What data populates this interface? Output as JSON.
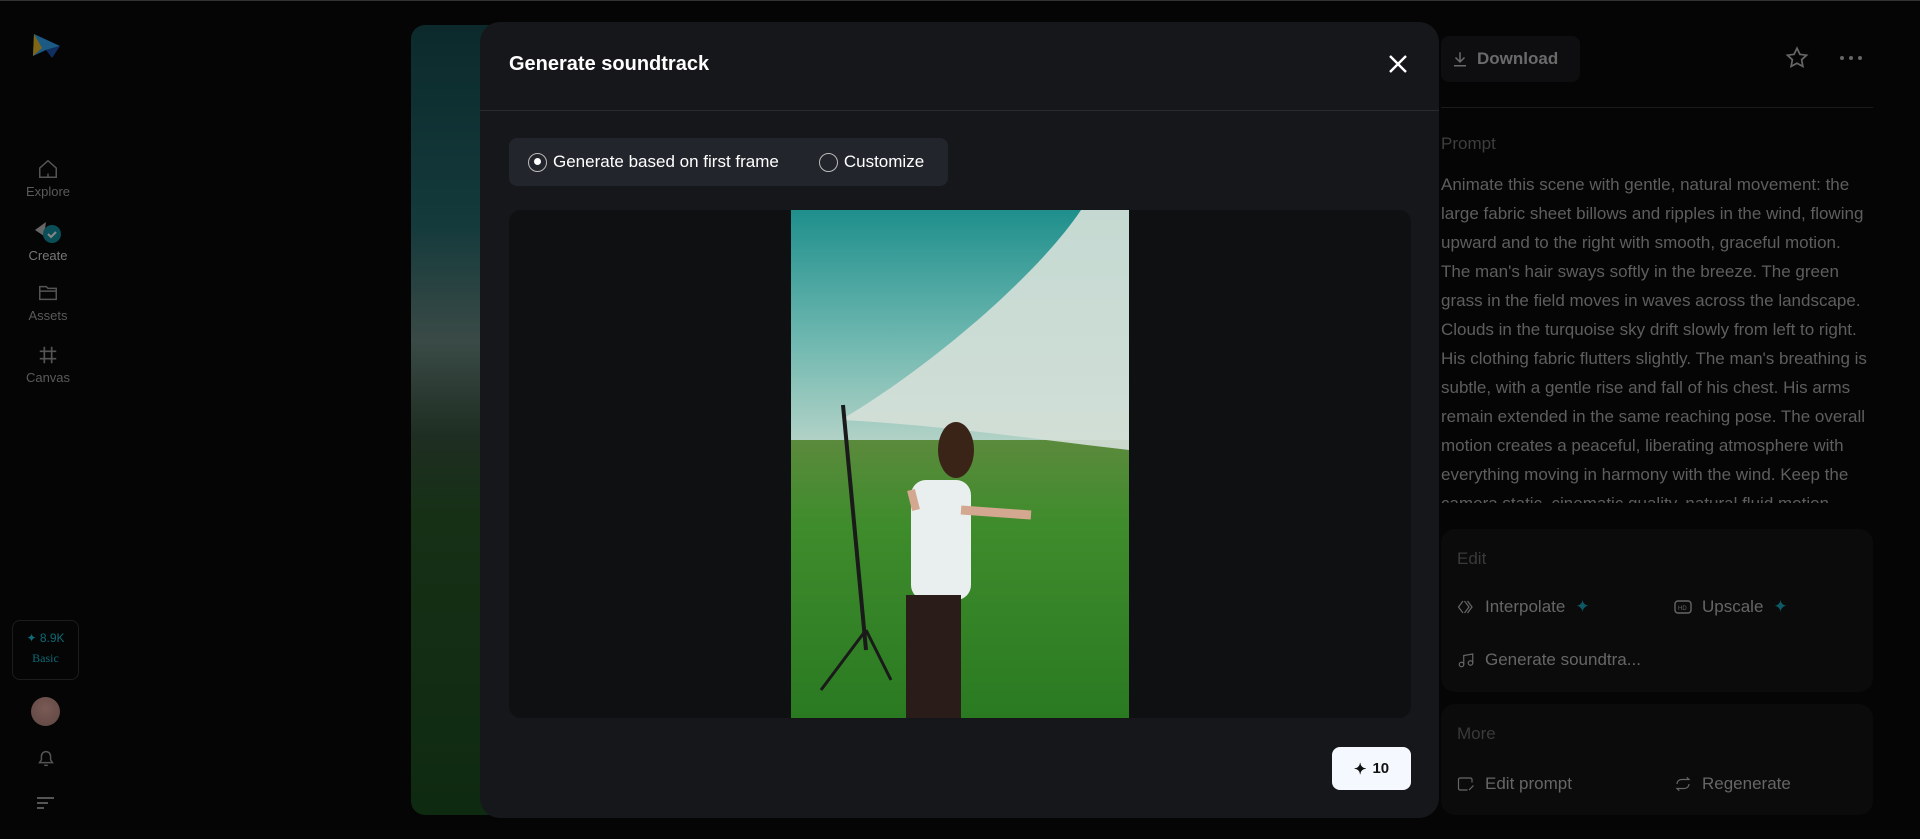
{
  "sidebar": {
    "nav": [
      {
        "label": "Explore",
        "icon": "home-icon"
      },
      {
        "label": "Create",
        "icon": "create-icon"
      },
      {
        "label": "Assets",
        "icon": "folder-icon"
      },
      {
        "label": "Canvas",
        "icon": "canvas-icon"
      }
    ],
    "credits": {
      "amount": "✦ 8.9K",
      "plan": "Basic"
    }
  },
  "detail": {
    "download_label": "Download",
    "prompt_label": "Prompt",
    "prompt_text": "Animate this scene with gentle, natural movement: the large fabric sheet billows and ripples in the wind, flowing upward and to the right with smooth, graceful motion. The man's hair sways softly in the breeze. The green grass in the field moves in waves across the landscape. Clouds in the turquoise sky drift slowly from left to right. His clothing fabric flutters slightly. The man's breathing is subtle, with a gentle rise and fall of his chest. His arms remain extended in the same reaching pose. The overall motion creates a peaceful, liberating atmosphere with everything moving in harmony with the wind. Keep the camera static, cinematic quality, natural fluid motion throughout.",
    "edit": {
      "title": "Edit",
      "interpolate": "Interpolate",
      "upscale": "Upscale",
      "soundtrack": "Generate soundtra..."
    },
    "more": {
      "title": "More",
      "edit_prompt": "Edit prompt",
      "regenerate": "Regenerate"
    }
  },
  "modal": {
    "title": "Generate soundtrack",
    "options": [
      {
        "label": "Generate based on first frame",
        "selected": true
      },
      {
        "label": "Customize",
        "selected": false
      }
    ],
    "generate_cost": "10",
    "accent": "#19a6b8"
  }
}
